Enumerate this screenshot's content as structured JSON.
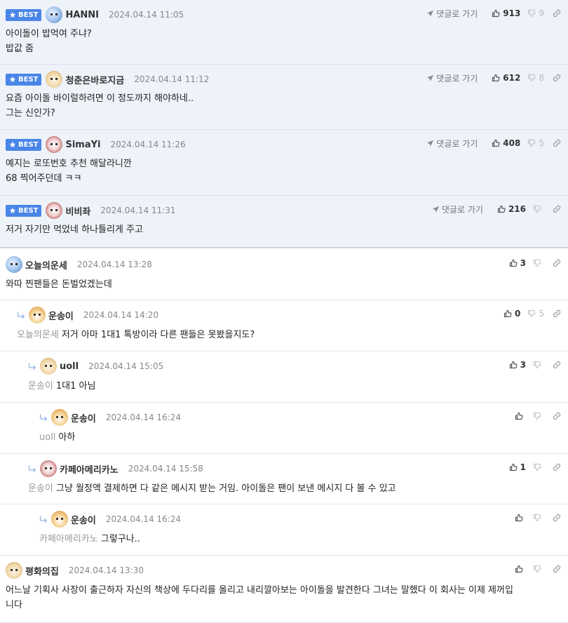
{
  "best_label": "BEST",
  "reply_go_label": "댓글로 가기",
  "comments": [
    {
      "nick": "HANNI",
      "date": "2024.04.14 11:05",
      "up": "913",
      "down": "9",
      "body": "아이돌이 밥먹여 주냐?\n밥값 줌"
    },
    {
      "nick": "청춘은바로지금",
      "date": "2024.04.14 11:12",
      "up": "612",
      "down": "8",
      "body": "요즘 아이돌 바이럴하려면 이 정도까지 해야하네..\n그는 신인가?"
    },
    {
      "nick": "SimaYi",
      "date": "2024.04.14 11:26",
      "up": "408",
      "down": "5",
      "body": "예지는 로또번호 추천 해달라니깐\n68 찍어주던데 ㅋㅋ"
    },
    {
      "nick": "비비좌",
      "date": "2024.04.14 11:31",
      "up": "216",
      "down": "",
      "body": "저거 자기만 먹었네 하나틀리게 주고"
    },
    {
      "nick": "오늘의운세",
      "date": "2024.04.14 13:28",
      "up": "3",
      "down": "",
      "body": "와따 찐팬들은 돈벌었겠는데"
    },
    {
      "nick": "운송이",
      "date": "2024.04.14 14:20",
      "up": "0",
      "down": "5",
      "mention": "오늘의운세",
      "body": "저거 아마 1대1 톡방이라 다른 팬들은 못봤을지도?"
    },
    {
      "nick": "uoll",
      "date": "2024.04.14 15:05",
      "up": "3",
      "down": "",
      "mention": "운송이",
      "body": "1대1 아님"
    },
    {
      "nick": "운송이",
      "date": "2024.04.14 16:24",
      "up": "",
      "down": "",
      "mention": "uoll",
      "body": "아하"
    },
    {
      "nick": "카페아메리카노",
      "date": "2024.04.14 15:58",
      "up": "1",
      "down": "",
      "mention": "운송이",
      "body": "그냥 월정액 결제하면 다 같은 메시지 받는 거임. 아이돌은 팬이 보낸 메시지 다 볼 수 있고"
    },
    {
      "nick": "운송이",
      "date": "2024.04.14 16:24",
      "up": "",
      "down": "",
      "mention": "카페아메리카노",
      "body": "그렇구나.."
    },
    {
      "nick": "평화의집",
      "date": "2024.04.14 13:30",
      "up": "",
      "down": "",
      "body": "어느날 기획사 사장이 출근하자 자신의 책상에 두다리를 올리고 내리깔아보는 아이돌을 발견한다 그녀는 말했다 이 회사는 이제 제꺼입\n니다"
    }
  ]
}
